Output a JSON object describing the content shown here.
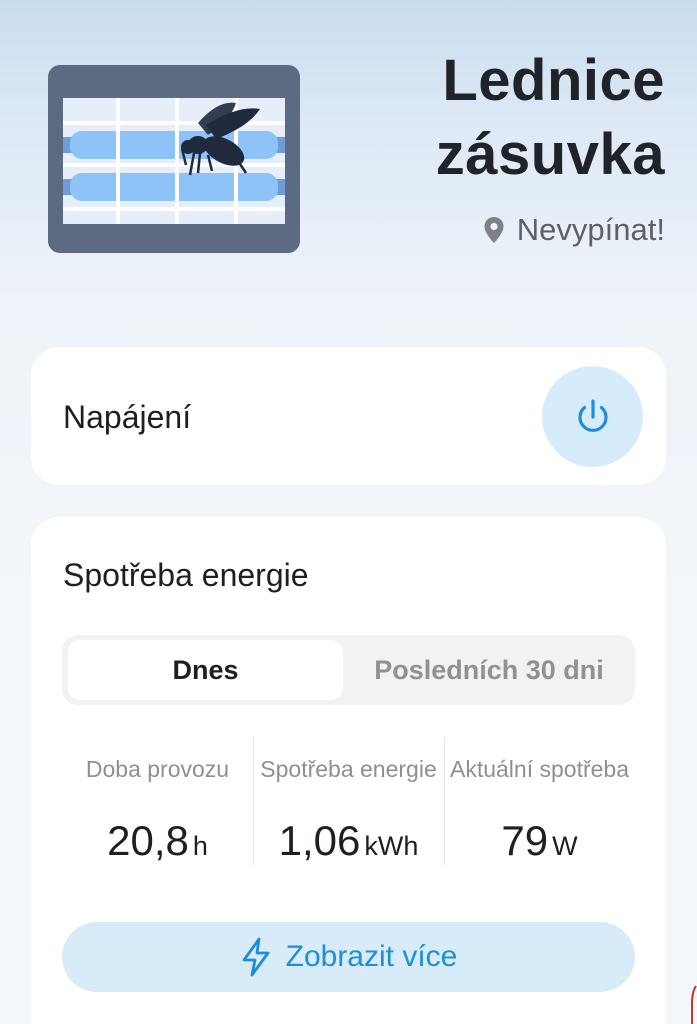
{
  "header": {
    "title_line1": "Lednice",
    "title_line2": "zásuvka",
    "location": "Nevypínat!",
    "device_icon": "mosquito-trap-icon",
    "location_icon": "location-pin-icon"
  },
  "power_card": {
    "label": "Napájení",
    "button_icon": "power-icon",
    "state": "off"
  },
  "energy_card": {
    "title": "Spotřeba energie",
    "tabs": [
      {
        "label": "Dnes",
        "selected": true
      },
      {
        "label": "Posledních 30 dni",
        "selected": false
      }
    ],
    "stats": [
      {
        "label": "Doba provozu",
        "value": "20,8",
        "unit": "h"
      },
      {
        "label": "Spotřeba energie",
        "value": "1,06",
        "unit": "kWh"
      },
      {
        "label": "Aktuální spotřeba",
        "value": "79",
        "unit": "W"
      }
    ],
    "more_button": {
      "label": "Zobrazit více",
      "icon": "lightning-icon"
    }
  },
  "colors": {
    "accent": "#1e8ed9",
    "power_button_bg": "#d7ecfb",
    "more_button_bg": "#d8ebf8",
    "trap_frame": "#5d6b82",
    "trap_tube": "#8ec3f7"
  }
}
